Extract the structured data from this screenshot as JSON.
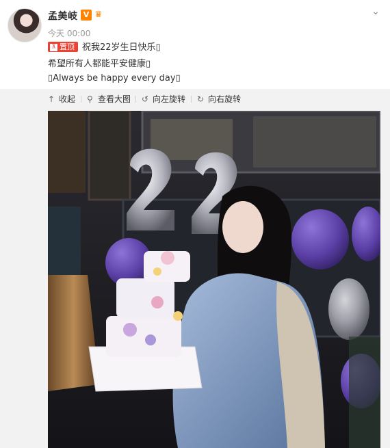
{
  "author": {
    "name": "孟美岐",
    "badge_v": "V",
    "badge_extra": "♛"
  },
  "post": {
    "time": "今天 00:00",
    "pin_label": "置顶",
    "pin_glyph": "⊼",
    "line1": "祝我22岁生日快乐▯",
    "line2": "希望所有人都能平安健康▯",
    "line3": "▯Always be happy every day▯"
  },
  "toolbar": {
    "collapse_label": "收起",
    "view_large_label": "查看大图",
    "rotate_left_label": "向左旋转",
    "rotate_right_label": "向右旋转"
  },
  "icons": {
    "collapse": "up-arrow-icon",
    "view_large": "magnifier-icon",
    "rotate_left": "rotate-left-icon",
    "rotate_right": "rotate-right-icon",
    "menu": "chevron-down-icon"
  },
  "photo": {
    "balloon_text": "22",
    "colors": {
      "balloon_silver": "#c8c8d0",
      "balloon_purple": "#5b3fa6",
      "jacket_denim": "#7f9cc4",
      "cake_white": "#f4f0f6"
    }
  }
}
